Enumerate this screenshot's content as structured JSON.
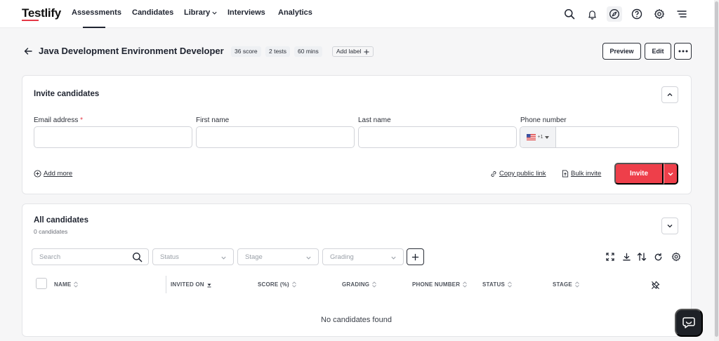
{
  "app": {
    "logo": "Testlify"
  },
  "nav": {
    "items": [
      {
        "label": "Assessments"
      },
      {
        "label": "Candidates"
      },
      {
        "label": "Library"
      },
      {
        "label": "Interviews"
      },
      {
        "label": "Analytics"
      }
    ],
    "active": "Assessments",
    "icons": [
      "search-icon",
      "bell-icon",
      "compass-icon",
      "help-icon",
      "gear-icon",
      "menu-icon"
    ]
  },
  "header": {
    "title": "Java Development Environment Developer",
    "badges": [
      "36 score",
      "2 tests",
      "60 mins"
    ],
    "add_label": "Add label",
    "preview": "Preview",
    "edit": "Edit"
  },
  "invite": {
    "title": "Invite candidates",
    "email_label": "Email address",
    "email_required": "*",
    "first_name_label": "First name",
    "last_name_label": "Last name",
    "phone_label": "Phone number",
    "phone_code": "+1",
    "add_more": "Add more",
    "copy_link": "Copy public link",
    "bulk_invite": "Bulk invite",
    "invite_button": "Invite"
  },
  "candidates": {
    "title": "All candidates",
    "count": "0 candidates",
    "search_placeholder": "Search",
    "filters": {
      "status": "Status",
      "stage": "Stage",
      "grading": "Grading"
    },
    "columns": [
      "NAME",
      "INVITED ON",
      "SCORE (%)",
      "GRADING",
      "PHONE NUMBER",
      "STATUS",
      "STAGE"
    ],
    "empty_text": "No candidates found"
  },
  "colors": {
    "accent": "#ee3f4a",
    "dark": "#1e2127"
  }
}
